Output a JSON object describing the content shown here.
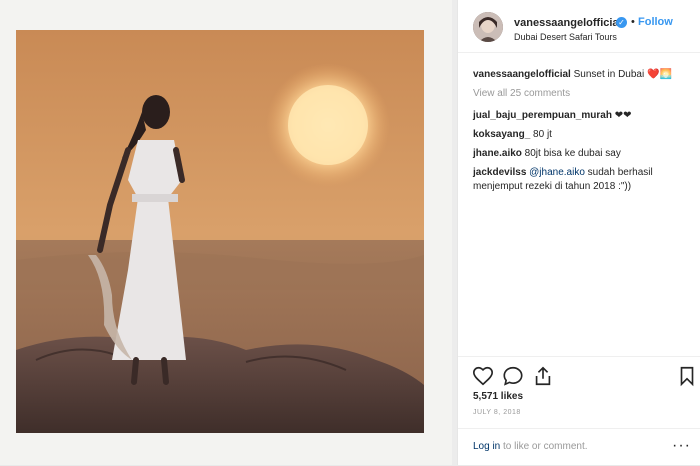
{
  "post": {
    "username": "vanessaangelofficial",
    "location": "Dubai Desert Safari Tours",
    "follow_label": "Follow",
    "dot": "•",
    "verified_mark": "✓",
    "caption_user": "vanessaangelofficial",
    "caption_text": " Sunset in Dubai ",
    "caption_emoji": "❤️🌅",
    "view_all": "View all 25 comments",
    "comments": [
      {
        "user": "jual_baju_perempuan_murah",
        "text": " ❤❤"
      },
      {
        "user": "koksayang_",
        "text": " 80 jt"
      },
      {
        "user": "jhane.aiko",
        "text": " 80jt bisa ke dubai say"
      },
      {
        "user": "jackdevilss",
        "mention": " @jhane.aiko",
        "text": " sudah berhasil menjemput rezeki di tahun 2018 :\"))"
      }
    ],
    "likes": "5,571 likes",
    "date": "JULY 8, 2018",
    "login_link": "Log in",
    "login_rest": " to like or comment.",
    "more": "···"
  },
  "icons": {
    "like": "heart-icon",
    "comment": "comment-icon",
    "share": "share-icon",
    "save": "bookmark-icon",
    "more": "more-options-icon",
    "verified": "verified-badge-icon"
  },
  "colors": {
    "link_blue": "#3897f0",
    "mention_blue": "#003569",
    "muted": "#999999",
    "text": "#262626"
  }
}
